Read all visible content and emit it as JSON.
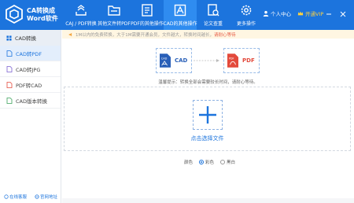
{
  "app": {
    "title_line1": "CA转换成",
    "title_line2": "Word软件"
  },
  "nav": [
    {
      "label": "CAJ / PDF转换",
      "icon": "convert-icon",
      "active": false
    },
    {
      "label": "其他文件转PDF",
      "icon": "folder-icon",
      "active": false
    },
    {
      "label": "PDF的其他操作",
      "icon": "pdf-tools-icon",
      "active": false
    },
    {
      "label": "CAD的其他操作",
      "icon": "cad-icon",
      "active": true
    },
    {
      "label": "论文查重",
      "icon": "paper-check-icon",
      "active": false
    },
    {
      "label": "更多操作",
      "icon": "gear-icon",
      "active": false
    }
  ],
  "user": {
    "center_label": "个人中心",
    "vip_label": "开通VIP"
  },
  "sidebar": {
    "header": "CAD转换",
    "items": [
      {
        "label": "CAD转PDF",
        "active": true
      },
      {
        "label": "CAD转JPG",
        "active": false
      },
      {
        "label": "PDF转CAD",
        "active": false
      },
      {
        "label": "CAD版本转换",
        "active": false
      }
    ],
    "footer_left": "在线客服",
    "footer_right": "官网地址"
  },
  "notice": {
    "text": "1M以内的免费转换，大于1M需要开通会员，文件越大，转换时间越长，",
    "highlight": "请耐心等待"
  },
  "conversion": {
    "from": "CAD",
    "to": "PDF"
  },
  "tip": "温馨提示：转换全部会需要较长时间，请耐心等待。",
  "drop": {
    "label": "点击选择文件"
  },
  "color_option": {
    "label": "颜色",
    "options": [
      "彩色",
      "黑白"
    ],
    "selected": "彩色"
  },
  "colors": {
    "primary": "#1c74dd",
    "active_tab": "#2f8cf0",
    "vip": "#ffd23e",
    "pdf_red": "#e34a3c",
    "cad_blue": "#2a60b8"
  }
}
